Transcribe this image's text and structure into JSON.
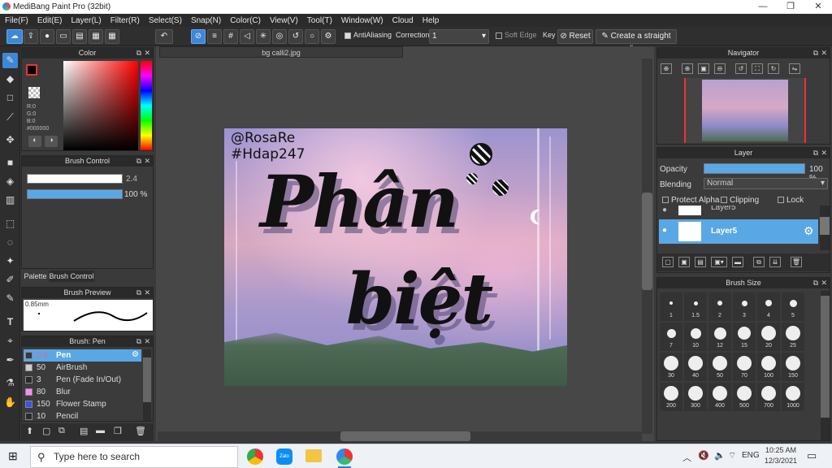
{
  "window": {
    "title": "MediBang Paint Pro (32bit)",
    "minimize": "—",
    "restore": "❐",
    "close": "✕"
  },
  "menu": [
    "File(F)",
    "Edit(E)",
    "Layer(L)",
    "Filter(R)",
    "Select(S)",
    "Snap(N)",
    "Color(C)",
    "View(V)",
    "Tool(T)",
    "Window(W)",
    "Cloud",
    "Help"
  ],
  "toolbar": {
    "antialiasing": "AntiAliasing",
    "correction_label": "Correction",
    "correction_value": "1",
    "soft_edge": "Soft Edge",
    "key": "Key",
    "reset": "Reset",
    "straight_line": "Create a straight line"
  },
  "color_panel": {
    "title": "Color",
    "r": "R:0",
    "g": "G:0",
    "b": "B:0",
    "hex": "#000000",
    "accent": "#ff0000"
  },
  "brush_control": {
    "title": "Brush Control",
    "size": "2.4",
    "opacity": "100 %"
  },
  "tabs": {
    "palette": "Palette",
    "brush_control": "Brush Control"
  },
  "brush_preview": {
    "title": "Brush Preview",
    "size": "0.85mm"
  },
  "brush_list": {
    "title": "Brush: Pen",
    "items": [
      {
        "size": "2.4",
        "name": "Pen",
        "color": "#3a3a3a",
        "selected": true
      },
      {
        "size": "50",
        "name": "AirBrush",
        "color": "#cfcfcf"
      },
      {
        "size": "3",
        "name": "Pen (Fade In/Out)",
        "color": "#2a2a2a"
      },
      {
        "size": "80",
        "name": "Blur",
        "color": "#ff88ff"
      },
      {
        "size": "150",
        "name": "Flower Stamp",
        "color": "#3355ee"
      },
      {
        "size": "10",
        "name": "Pencil",
        "color": "#2a2a2a"
      }
    ]
  },
  "document": {
    "tab": "bg calli2.jpg",
    "handle_line1": "@RosaRe",
    "handle_line2": "#Hdap247",
    "word1": "Phân",
    "word2": "biệt"
  },
  "navigator": {
    "title": "Navigator"
  },
  "layer_panel": {
    "title": "Layer",
    "opacity_label": "Opacity",
    "opacity_value": "100 %",
    "opacity_pct": 100,
    "blending_label": "Blending",
    "blending_value": "Normal",
    "protect_alpha": "Protect Alpha",
    "clipping": "Clipping",
    "lock": "Lock",
    "layers": [
      {
        "name": "Layer5"
      },
      {
        "name": "Layer5",
        "selected": true
      }
    ]
  },
  "brush_size": {
    "title": "Brush Size",
    "sizes": [
      "1",
      "1.5",
      "2",
      "3",
      "4",
      "5",
      "7",
      "10",
      "12",
      "15",
      "20",
      "25",
      "30",
      "40",
      "50",
      "70",
      "100",
      "150",
      "200",
      "300",
      "400",
      "500",
      "700",
      "1000"
    ]
  },
  "taskbar": {
    "search_placeholder": "Type here to search",
    "language": "ENG",
    "time": "10:25 AM",
    "date": "12/3/2021"
  }
}
